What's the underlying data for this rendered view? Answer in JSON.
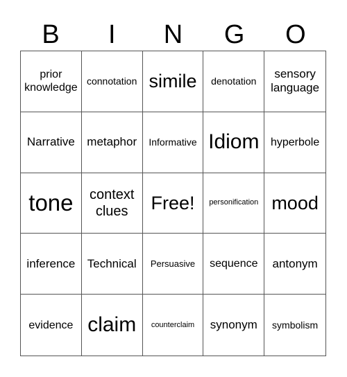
{
  "header": [
    "B",
    "I",
    "N",
    "G",
    "O"
  ],
  "cells": [
    [
      "prior knowledge",
      "connotation",
      "simile",
      "denotation",
      "sensory language"
    ],
    [
      "Narrative",
      "metaphor",
      "Informative",
      "Idiom",
      "hyperbole"
    ],
    [
      "tone",
      "context clues",
      "Free!",
      "personification",
      "mood"
    ],
    [
      "inference",
      "Technical",
      "Persuasive",
      "sequence",
      "antonym"
    ],
    [
      "evidence",
      "claim",
      "counterclaim",
      "synonym",
      "symbolism"
    ]
  ]
}
